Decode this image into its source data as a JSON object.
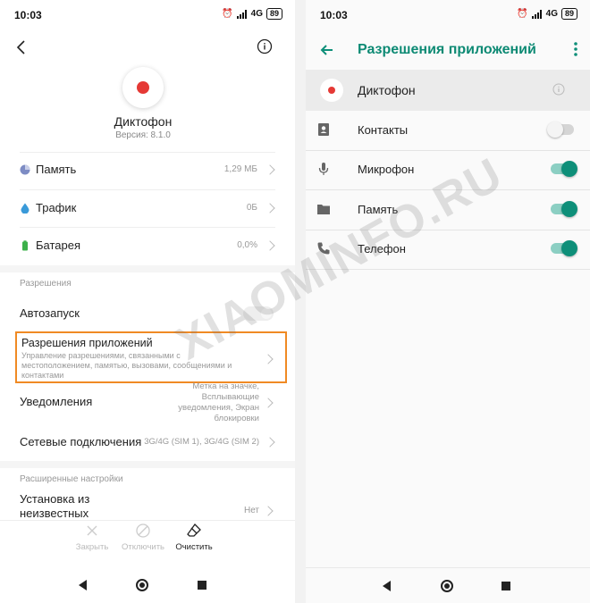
{
  "left": {
    "status": {
      "time": "10:03",
      "network": "4G",
      "battery": "89"
    },
    "app_name": "Диктофон",
    "version": "Версия: 8.1.0",
    "rows": {
      "memory": {
        "label": "Память",
        "value": "1,29 МБ"
      },
      "traffic": {
        "label": "Трафик",
        "value": "0Б"
      },
      "battery": {
        "label": "Батарея",
        "value": "0,0%"
      }
    },
    "permissions_section": "Разрешения",
    "autostart": {
      "label": "Автозапуск",
      "enabled": false
    },
    "app_permissions": {
      "label": "Разрешения приложений",
      "description": "Управление разрешениями, связанными с местоположением, памятью, вызовами, сообщениями и контактами"
    },
    "notifications": {
      "label": "Уведомления",
      "value": "Метка на значке, Всплывающие уведомления, Экран блокировки"
    },
    "network": {
      "label": "Сетевые подключения",
      "value": "3G/4G (SIM 1), 3G/4G (SIM 2)"
    },
    "advanced_section": "Расширенные настройки",
    "unknown_sources": {
      "label": "Установка из неизвестных",
      "value": "Нет"
    },
    "actions": {
      "close": "Закрыть",
      "disable": "Отключить",
      "clear": "Очистить"
    }
  },
  "right": {
    "status": {
      "time": "10:03",
      "network": "4G",
      "battery": "89"
    },
    "title": "Разрешения приложений",
    "app_name": "Диктофон",
    "accent": "#0e8f79",
    "permissions": [
      {
        "label": "Контакты",
        "icon": "contacts-icon",
        "enabled": false
      },
      {
        "label": "Микрофон",
        "icon": "mic-icon",
        "enabled": true
      },
      {
        "label": "Память",
        "icon": "folder-icon",
        "enabled": true
      },
      {
        "label": "Телефон",
        "icon": "phone-icon",
        "enabled": true
      }
    ]
  },
  "watermark": "XIAOMINFO.RU"
}
